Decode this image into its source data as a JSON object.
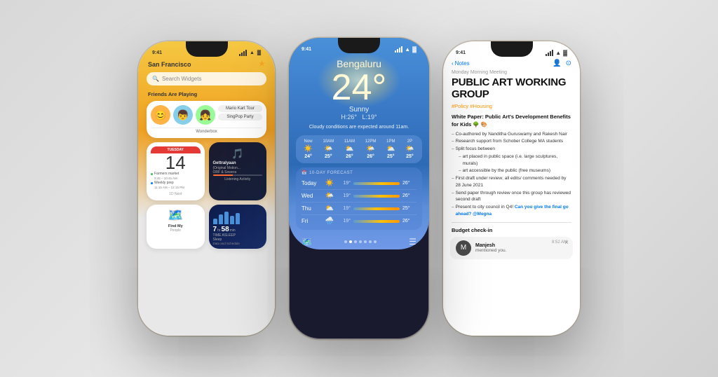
{
  "background": "#e0ddd8",
  "phones": {
    "left": {
      "status": {
        "time": "9:41",
        "signal": "●●●",
        "wifi": "wifi",
        "battery": "100%"
      },
      "header": "San Francisco",
      "search_placeholder": "Search Widgets",
      "section_label": "Friends Are Playing",
      "friends_widget": {
        "games": [
          "Mario Kart Tour",
          "SingPop Party"
        ],
        "apps": [
          "Wonderbox"
        ],
        "label": "Friends Are Playing"
      },
      "calendar_widget": {
        "month": "TUESDAY",
        "date": "14",
        "events": [
          "Farmers market",
          "9:45 – 10:45 AM",
          "Weekly prep",
          "11:15 AM – 12:15 PM"
        ],
        "label": "1D Next"
      },
      "music_widget": {
        "title": "Gettralyaan",
        "subtitle": "(Original Motion...",
        "artists": "ORF & Sowera",
        "label": "Listening Activity"
      },
      "findmy_widget": {
        "label": "Find My",
        "sublabel": "People"
      },
      "sleep_widget": {
        "label": "Sleep",
        "sublabel": "Data and Schedule",
        "time_asleep_label": "TIME ASLEEP",
        "hours": "7",
        "mins": "58",
        "min_label": "min"
      }
    },
    "center": {
      "status": {
        "time": "9:41",
        "signal": "●●●",
        "wifi": "wifi",
        "battery": "100%"
      },
      "city": "Bengaluru",
      "temperature": "24°",
      "condition": "Sunny",
      "high": "H:26°",
      "low": "L:19°",
      "alert": "Cloudy conditions are expected around 11am.",
      "hourly": [
        {
          "time": "Now",
          "icon": "☀️",
          "temp": "24°"
        },
        {
          "time": "10AM",
          "icon": "🌤️",
          "temp": "25°"
        },
        {
          "time": "11AM",
          "icon": "⛅",
          "temp": "26°"
        },
        {
          "time": "12PM",
          "icon": "🌤️",
          "temp": "26°"
        },
        {
          "time": "1PM",
          "icon": "⛅",
          "temp": "25°"
        },
        {
          "time": "2P",
          "icon": "🌤️",
          "temp": "25°"
        }
      ],
      "forecast_header": "10-DAY FORECAST",
      "forecast": [
        {
          "day": "Today",
          "icon": "☀️",
          "low": "19°",
          "high": "26°",
          "bar_pct": 60
        },
        {
          "day": "Wed",
          "icon": "🌤️",
          "low": "19°",
          "high": "26°",
          "bar_pct": 60
        },
        {
          "day": "Thu",
          "icon": "⛅",
          "low": "19°",
          "high": "25°",
          "bar_pct": 50
        },
        {
          "day": "Fri",
          "icon": "🌧️",
          "low": "19°",
          "high": "26°",
          "bar_pct": 60
        }
      ]
    },
    "right": {
      "status": {
        "time": "9:41",
        "signal": "●●●",
        "wifi": "wifi",
        "battery": "100%"
      },
      "nav_back": "Notes",
      "note_title": "Monday Morning Meeting",
      "note_heading": "Public Art Working Group",
      "tags": "#Policy #Housing",
      "content_title": "White Paper: Public Art's Development Benefits for Kids 🌳 🎨",
      "items": [
        "Co-authored by Nanditha Guruswamy and Rakesh Nair",
        "Research support from Schober College MA students",
        "Split focus between",
        "art placed in public space (i.e. large sculptures, murals)",
        "art accessible by the public (free museums)",
        "First draft under review; all edits/ comments needed by 28 June 2021",
        "Send paper through review once this group has reviewed second draft",
        "Present to city council in Q4! Can you give the final go ahead? @Megna"
      ],
      "budget_label": "Budget check-in",
      "notification": {
        "name": "Manjesh",
        "text": "mentioned you.",
        "time": "8:52 AM"
      }
    }
  }
}
